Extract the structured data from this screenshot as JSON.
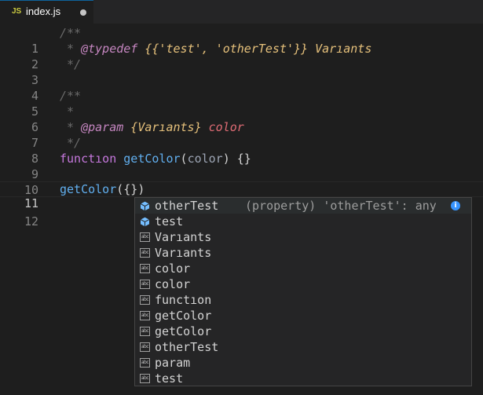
{
  "tab": {
    "lang_badge": "JS",
    "filename": "index.js"
  },
  "editor": {
    "lines": [
      {
        "num": "1"
      },
      {
        "num": "2"
      },
      {
        "num": "3"
      },
      {
        "num": "4"
      },
      {
        "num": "5"
      },
      {
        "num": "6"
      },
      {
        "num": "7"
      },
      {
        "num": "8"
      },
      {
        "num": "9"
      },
      {
        "num": "10"
      },
      {
        "num": "11"
      },
      {
        "num": "12"
      }
    ],
    "code": {
      "l1": "/**",
      "l2_star": " * ",
      "l2_tag": "@typedef",
      "l2_type": " {{'test', 'otherTest'}} Varıants",
      "l3": " */",
      "l5": "/**",
      "l6": " *",
      "l7_star": " * ",
      "l7_tag": "@param",
      "l7_type": " {Varıants} ",
      "l7_param": "color",
      "l8": " */",
      "l9_kw": "functıon",
      "l9_sp": " ",
      "l9_fn": "getColor",
      "l9_open": "(",
      "l9_arg": "color",
      "l9_close": ") {}",
      "l11_fn": "getColor",
      "l11_rest": "({})"
    }
  },
  "suggest": {
    "items": [
      {
        "label": "otherTest",
        "icon": "property-icon",
        "detail": "(property) 'otherTest': any"
      },
      {
        "label": "test",
        "icon": "property-icon"
      },
      {
        "label": "Varıants",
        "icon": "word-icon"
      },
      {
        "label": "Varıants",
        "icon": "word-icon"
      },
      {
        "label": "color",
        "icon": "word-icon"
      },
      {
        "label": "color",
        "icon": "word-icon"
      },
      {
        "label": "functıon",
        "icon": "word-icon"
      },
      {
        "label": "getColor",
        "icon": "word-icon"
      },
      {
        "label": "getColor",
        "icon": "word-icon"
      },
      {
        "label": "otherTest",
        "icon": "word-icon"
      },
      {
        "label": "param",
        "icon": "word-icon"
      },
      {
        "label": "test",
        "icon": "word-icon"
      }
    ],
    "info_glyph": "i",
    "word_icon_text": "abc"
  }
}
